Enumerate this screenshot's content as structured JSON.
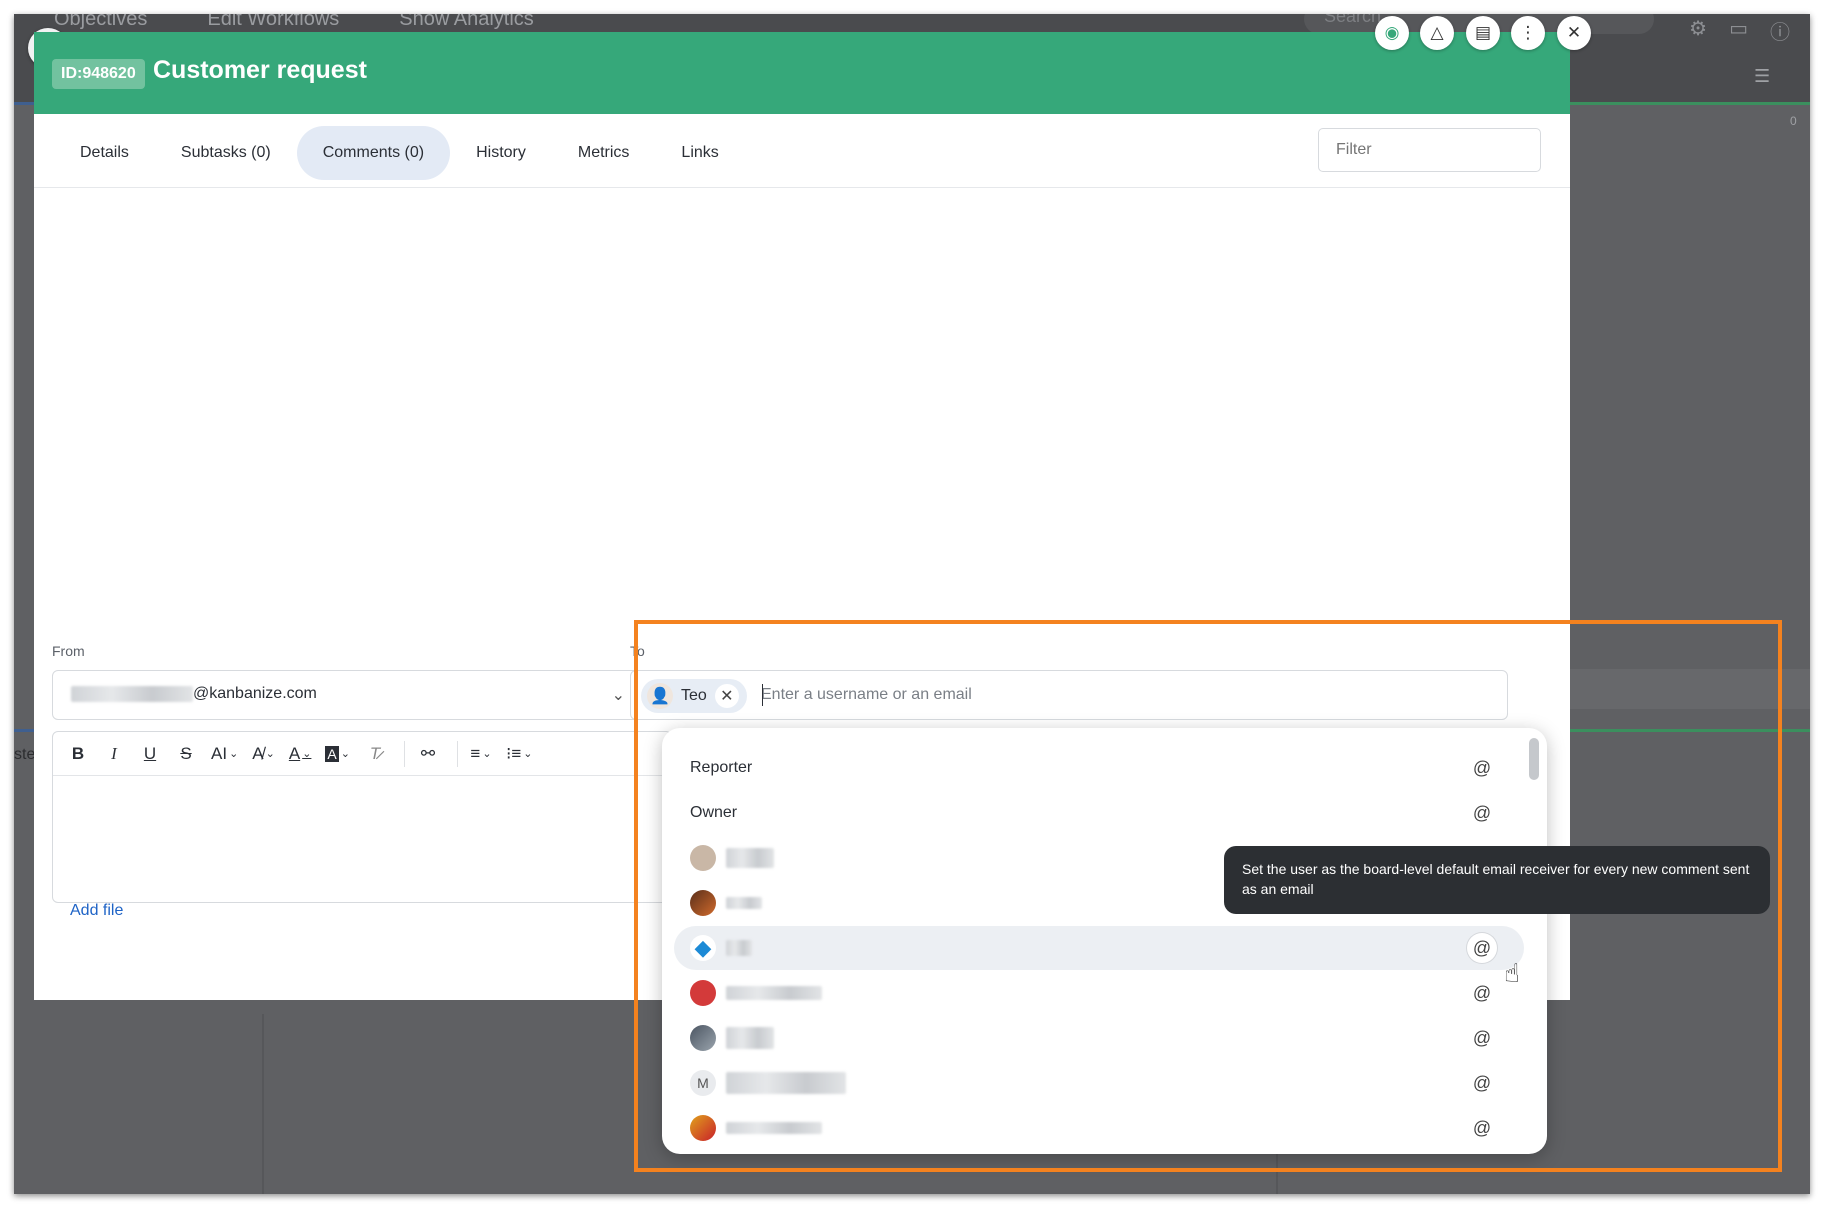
{
  "background": {
    "nav": [
      "Objectives",
      "Edit Workflows",
      "Show Analytics"
    ],
    "search_placeholder": "Search",
    "count": "0",
    "side_text": "ste"
  },
  "card": {
    "id_badge": "ID:948620",
    "title": "Customer request",
    "header_icons": [
      "palette-icon",
      "triangle-icon",
      "layout-icon",
      "more-vertical-icon",
      "close-icon"
    ]
  },
  "tabs": [
    {
      "label": "Details"
    },
    {
      "label": "Subtasks (0)"
    },
    {
      "label": "Comments (0)",
      "active": true
    },
    {
      "label": "History"
    },
    {
      "label": "Metrics"
    },
    {
      "label": "Links"
    }
  ],
  "filter": {
    "placeholder": "Filter"
  },
  "from": {
    "label": "From",
    "value_suffix": "@kanbanize.com"
  },
  "editor": {
    "toolbar": [
      "bold",
      "italic",
      "underline",
      "strikethrough",
      "font-size",
      "font-style",
      "text-color",
      "background-color",
      "clear-formatting",
      "link",
      "align",
      "bulleted-list",
      "numbered-list"
    ]
  },
  "add_file": "Add file",
  "to": {
    "label": "To",
    "chip": "Teo",
    "placeholder": "Enter a username or an email"
  },
  "dropdown": {
    "items": [
      "Reporter",
      "Owner"
    ]
  },
  "tooltip": "Set the user as the board-level default email receiver for every new comment sent as an email",
  "colors": {
    "header": "#36a87a",
    "accent_tab": "#e3eaf5",
    "highlight": "#f4821f",
    "link": "#1e63c6"
  }
}
